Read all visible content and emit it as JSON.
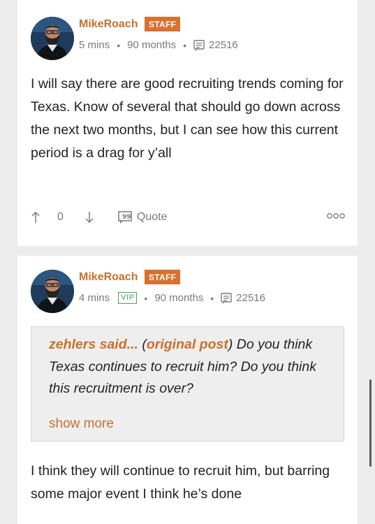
{
  "posts": [
    {
      "username": "MikeRoach",
      "badge": "STAFF",
      "time": "5 mins",
      "tenure": "90 months",
      "post_count": "22516",
      "body": "I will say there are good recruiting trends coming for Texas. Know of several that should go down across the next two months, but I can see how this current period is a drag for y’all",
      "upvotes": "0",
      "quote_label": "Quote"
    },
    {
      "username": "MikeRoach",
      "badge": "STAFF",
      "time": "4 mins",
      "vip": "VIP",
      "tenure": "90 months",
      "post_count": "22516",
      "quote": {
        "author": "zehlers said...",
        "original_link": "original post",
        "text": " Do you think Texas continues to recruit him? Do you think this recruitment is over?",
        "show_more": "show more"
      },
      "body": "I think they will continue to recruit him, but barring some major event I think he’s done"
    }
  ]
}
